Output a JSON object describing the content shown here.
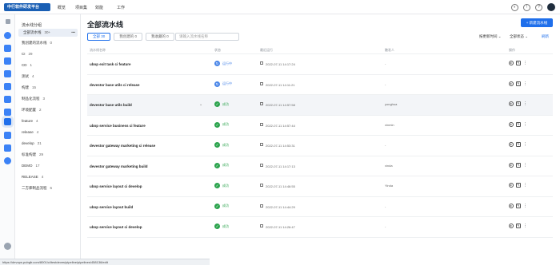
{
  "topbar": {
    "logo": "中行软件研发平台",
    "nav": [
      "概览",
      "项目集",
      "效能",
      "工作"
    ]
  },
  "sidebar": {
    "heading": "流水线分组",
    "items": [
      {
        "label": "全部流水线",
        "count": "30+",
        "selected": true
      },
      {
        "label": "我创建的流水线",
        "count": "0"
      },
      {
        "label": "CI",
        "count": "29"
      },
      {
        "label": "CD",
        "count": "1"
      },
      {
        "label": "测试",
        "count": "4"
      },
      {
        "label": "构建",
        "count": "15"
      },
      {
        "label": "制品化流程",
        "count": "3"
      },
      {
        "label": "环境配置",
        "count": "2"
      },
      {
        "label": "feature",
        "count": "4"
      },
      {
        "label": "release",
        "count": "4"
      },
      {
        "label": "develop",
        "count": "21"
      },
      {
        "label": "标准构建",
        "count": "29"
      },
      {
        "label": "DEMO",
        "count": "17"
      },
      {
        "label": "RELEASE",
        "count": "4"
      },
      {
        "label": "二方库制品流程",
        "count": "6"
      }
    ]
  },
  "main": {
    "title": "全部流水线",
    "new_button": "+ 新建流水线",
    "tabs": [
      "全部 30",
      "我创建的 0",
      "我收藏的 0"
    ],
    "search_placeholder": "请输入流水线名称",
    "sort_label": "按更新时间 ⌄",
    "filter_label": "全部状态 ⌄",
    "refresh_label": "刷新",
    "columns": [
      "流水线名称",
      "状态",
      "最近运行",
      "触发人",
      "操作"
    ]
  },
  "rows": [
    {
      "name": "ubop exit task ci feature",
      "status": "运行中",
      "status_kind": "running",
      "time": "2022-07-11 14:17:24",
      "who": "-"
    },
    {
      "name": "devestor base utils ci release",
      "status": "运行中",
      "status_kind": "running",
      "time": "2022-07-11 14:11:21",
      "who": "-"
    },
    {
      "name": "devestor base utils build",
      "status": "成功",
      "status_kind": "success",
      "time": "2022-07-11 14:57:58",
      "who": "yonghua"
    },
    {
      "name": "ubop service business ci feature",
      "status": "成功",
      "status_kind": "success",
      "time": "2022-07-11 14:57:44",
      "who": "xinmin"
    },
    {
      "name": "devestor gateway marketing ci release",
      "status": "成功",
      "status_kind": "success",
      "time": "2022-07-11 14:53:31",
      "who": "-"
    },
    {
      "name": "devestor gateway marketing build",
      "status": "成功",
      "status_kind": "success",
      "time": "2022-07-11 14:17:13",
      "who": "xinda"
    },
    {
      "name": "ubop service layout ci develop",
      "status": "成功",
      "status_kind": "success",
      "time": "2022-07-11 14:46:55",
      "who": "Yinda"
    },
    {
      "name": "ubop service layout build",
      "status": "成功",
      "status_kind": "success",
      "time": "2022-07-11 14:44:29",
      "who": "-"
    },
    {
      "name": "ubop service layout ci develop",
      "status": "成功",
      "status_kind": "success",
      "time": "2022-07-11 14:26:47",
      "who": "-"
    }
  ],
  "statusbar": "https://devops.pubgfr.com/8001/ci/testdeves/pipeline/pipelines/458136/edit"
}
